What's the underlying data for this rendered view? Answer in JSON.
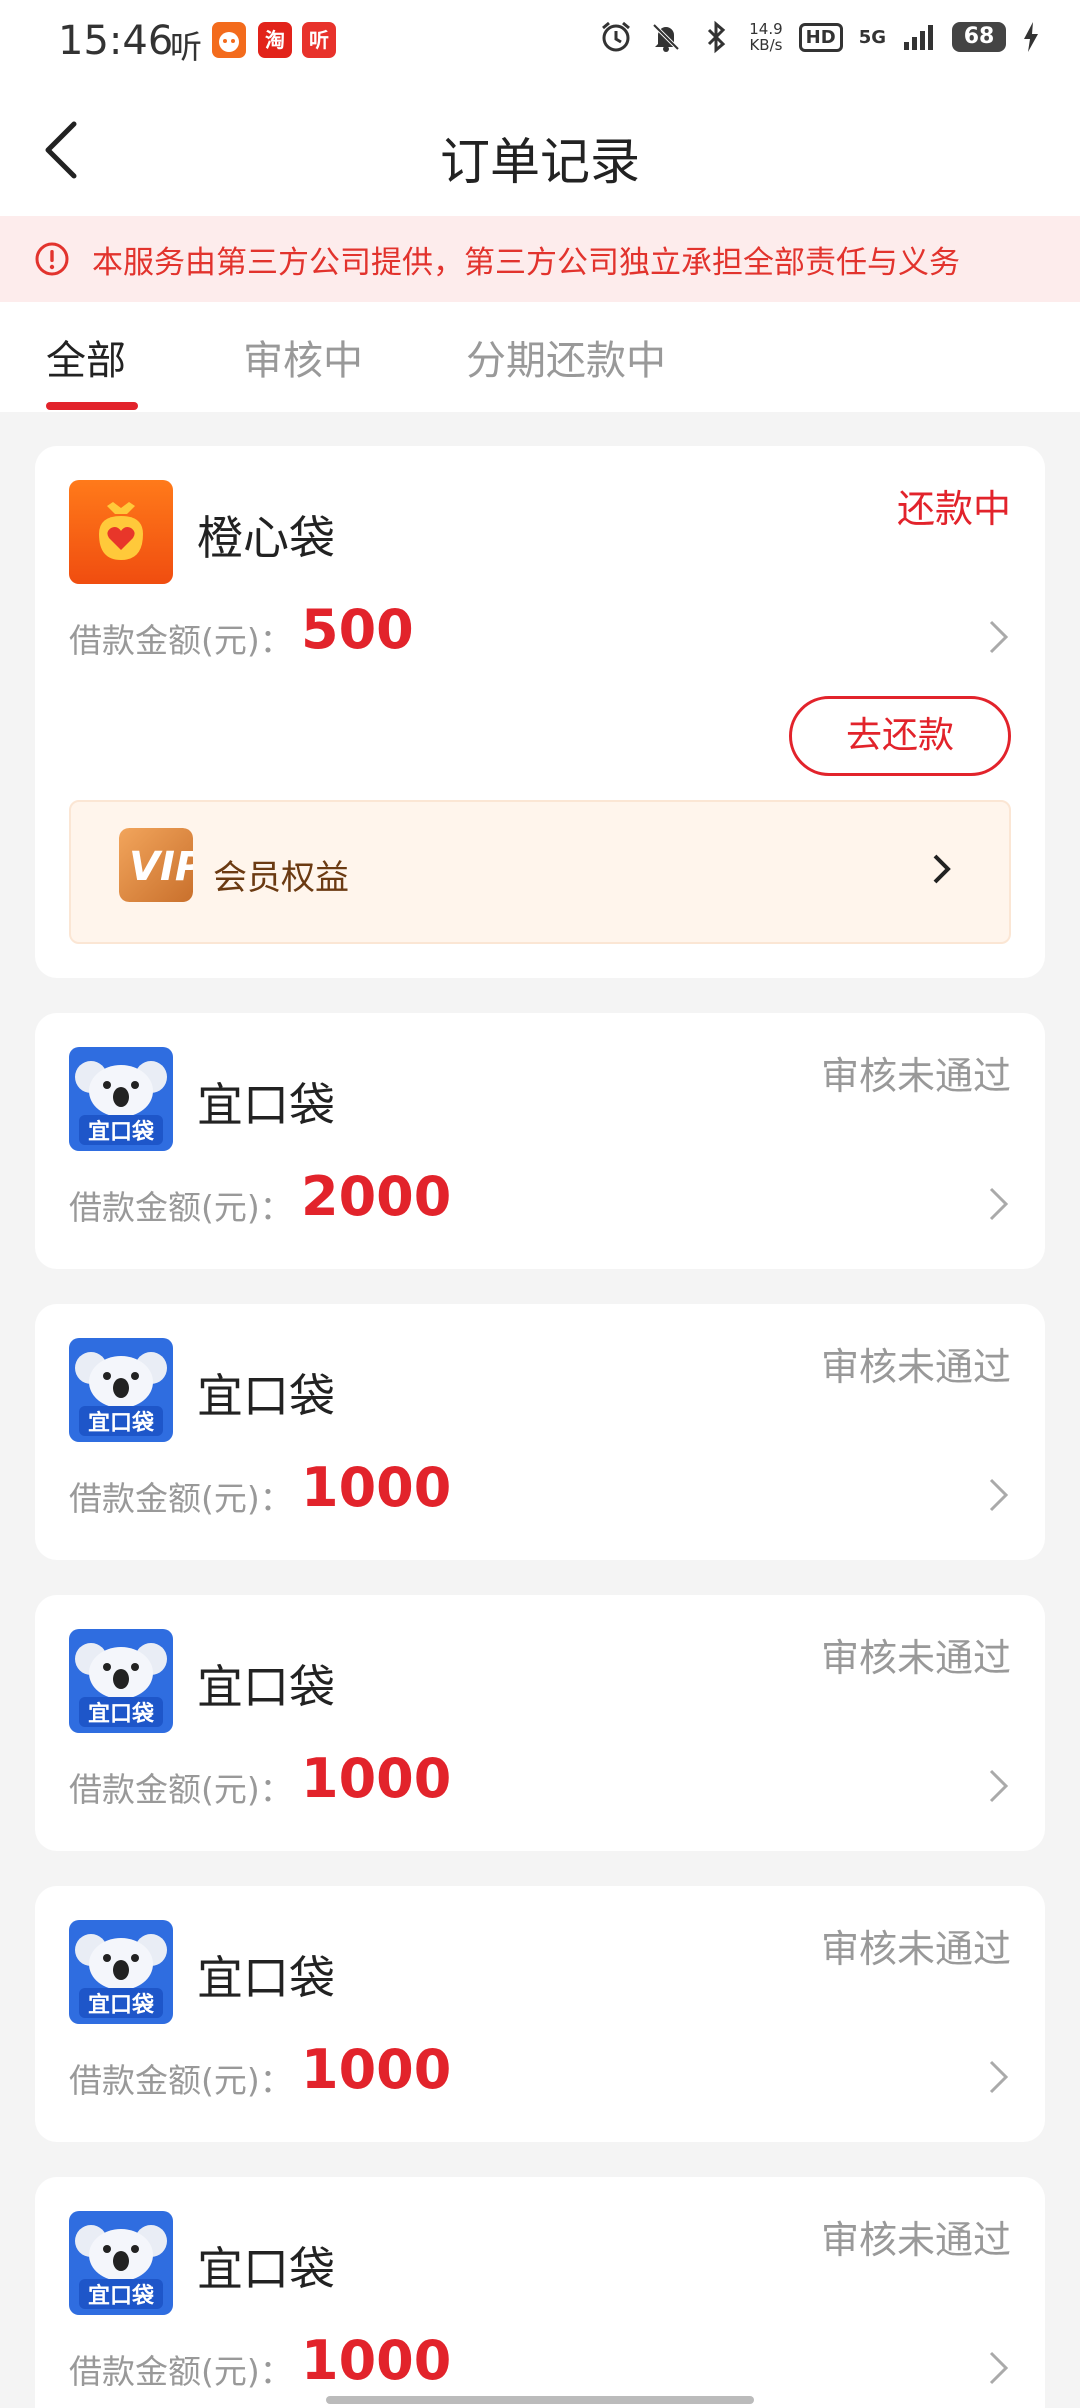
{
  "status_bar": {
    "time": "15:46",
    "listen_glyph": "听",
    "app_icons": [
      "orange-app-icon",
      "taobao-icon",
      "ting-app-icon"
    ],
    "taobao_glyph": "淘",
    "ting_glyph": "听",
    "net_speed_value": "14.9",
    "net_speed_unit": "KB/s",
    "hd": "HD",
    "network": "5G",
    "battery": "68"
  },
  "header": {
    "title": "订单记录"
  },
  "notice": {
    "text": "本服务由第三方公司提供，第三方公司独立承担全部责任与义务"
  },
  "tabs": {
    "items": [
      {
        "label": "全部"
      },
      {
        "label": "审核中"
      },
      {
        "label": "分期还款中"
      }
    ],
    "active_index": 0
  },
  "orders": [
    {
      "name": "橙心袋",
      "status": "还款中",
      "amount_label": "借款金额(元)：",
      "amount": "500",
      "action_label": "去还款",
      "vip_label": "会员权益"
    },
    {
      "name": "宜口袋",
      "status": "审核未通过",
      "amount_label": "借款金额(元)：",
      "amount": "2000"
    },
    {
      "name": "宜口袋",
      "status": "审核未通过",
      "amount_label": "借款金额(元)：",
      "amount": "1000"
    },
    {
      "name": "宜口袋",
      "status": "审核未通过",
      "amount_label": "借款金额(元)：",
      "amount": "1000"
    },
    {
      "name": "宜口袋",
      "status": "审核未通过",
      "amount_label": "借款金额(元)：",
      "amount": "1000"
    },
    {
      "name": "宜口袋",
      "status": "审核未通过",
      "amount_label": "借款金额(元)：",
      "amount": "1000"
    }
  ],
  "logos": {
    "koala_logo_text": "宜口袋",
    "vip_logo_text": "VIP"
  },
  "colors": {
    "accent_red": "#e2232b",
    "notice_bg": "#fdecec",
    "status_grey": "#999999",
    "page_bg": "#f4f4f4"
  }
}
